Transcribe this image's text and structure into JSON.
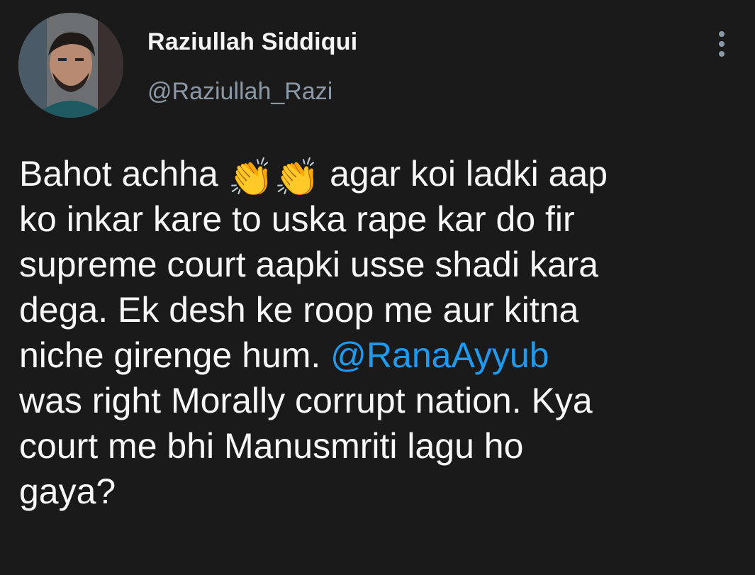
{
  "tweet": {
    "author": {
      "display_name": "Raziullah Siddiqui",
      "handle": "@Raziullah_Razi"
    },
    "menu_icon": "more-vertical-icon",
    "lines": [
      {
        "before": "Bahot achha",
        "emoji": "👏👏",
        "after": " agar koi ladki aap"
      },
      {
        "text": "ko inkar kare to uska rape kar do fir"
      },
      {
        "text": "supreme court aapki usse shadi kara"
      },
      {
        "text": "dega. Ek desh ke roop me aur kitna"
      },
      {
        "before": "niche girenge hum. ",
        "mention": "@RanaAyyub"
      },
      {
        "text": "was right Morally corrupt nation. Kya"
      },
      {
        "text": "court me bhi Manusmriti lagu ho"
      },
      {
        "text": "gaya?"
      }
    ]
  },
  "colors": {
    "background": "#1a1a1a",
    "text": "#f7f7f7",
    "secondary": "#8b98a5",
    "link": "#1d9bf0"
  }
}
